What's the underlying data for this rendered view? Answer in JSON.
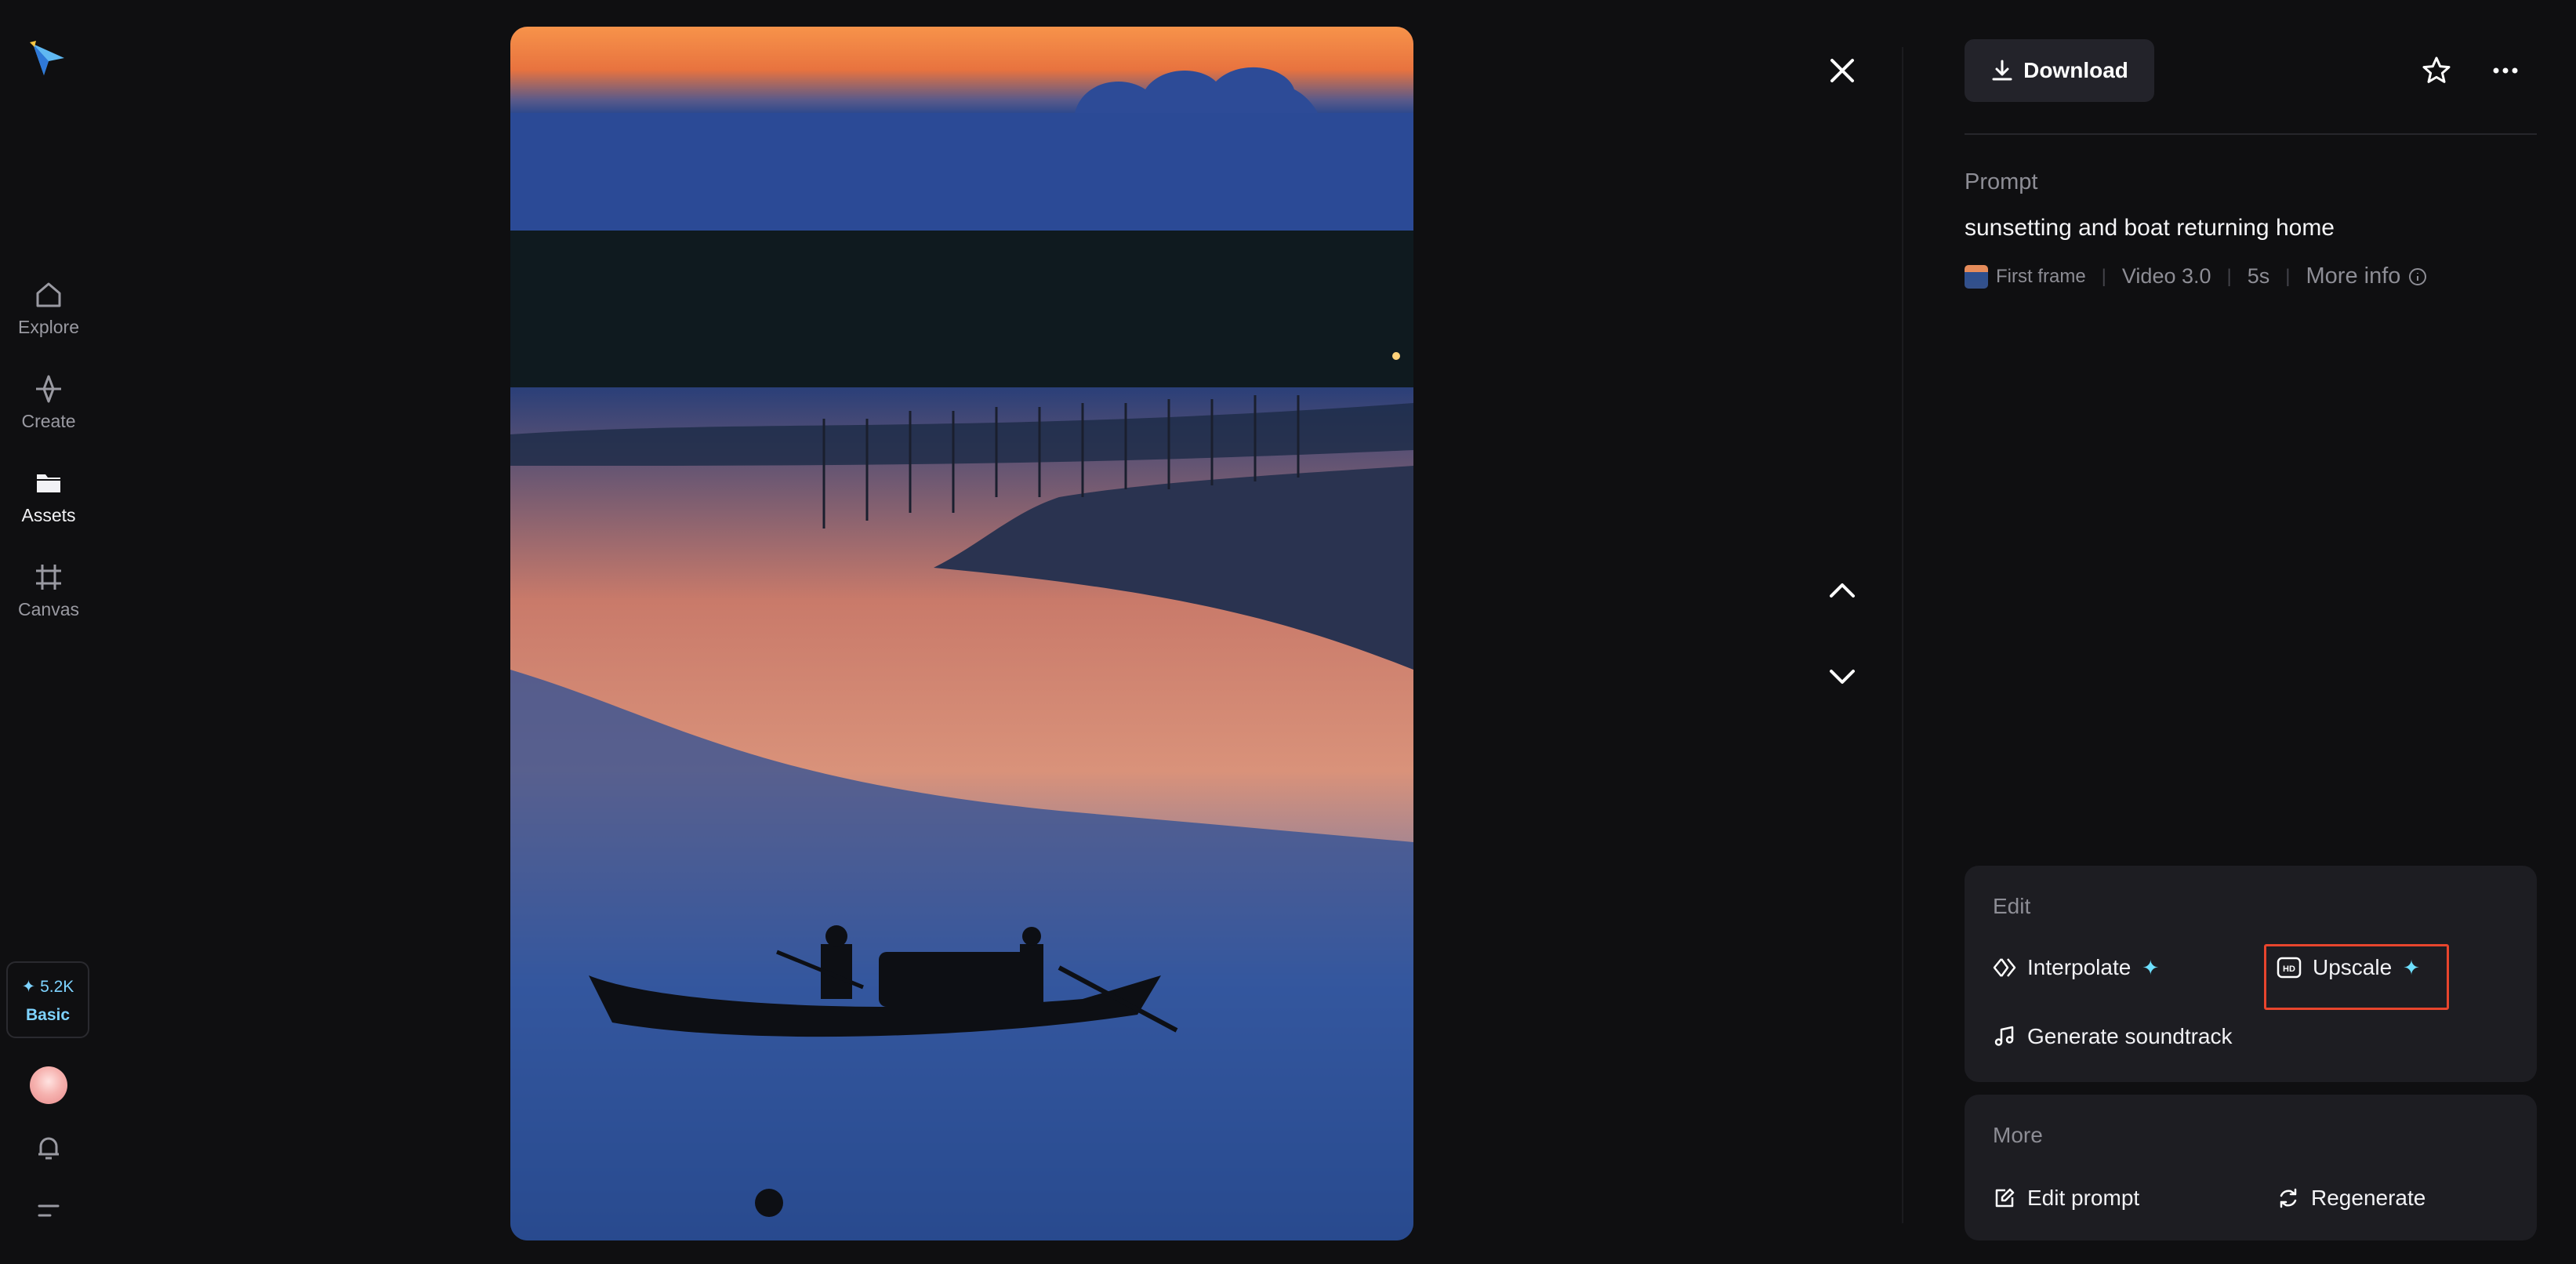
{
  "sidebar": {
    "items": [
      {
        "label": "Explore"
      },
      {
        "label": "Create"
      },
      {
        "label": "Assets"
      },
      {
        "label": "Canvas"
      }
    ],
    "credits": {
      "amount": "✦ 5.2K",
      "plan": "Basic"
    }
  },
  "toolbar": {
    "download_label": "Download"
  },
  "prompt": {
    "label": "Prompt",
    "text": "sunsetting and boat returning home",
    "meta": {
      "first_frame": "First frame",
      "model": "Video 3.0",
      "duration": "5s",
      "more_info": "More info"
    }
  },
  "edit": {
    "title": "Edit",
    "interpolate": "Interpolate",
    "upscale": "Upscale",
    "soundtrack": "Generate soundtrack"
  },
  "more": {
    "title": "More",
    "edit_prompt": "Edit prompt",
    "regenerate": "Regenerate"
  },
  "colors": {
    "accent": "#6ee0ff",
    "highlight": "#e8452d",
    "background": "#0f0f11"
  }
}
